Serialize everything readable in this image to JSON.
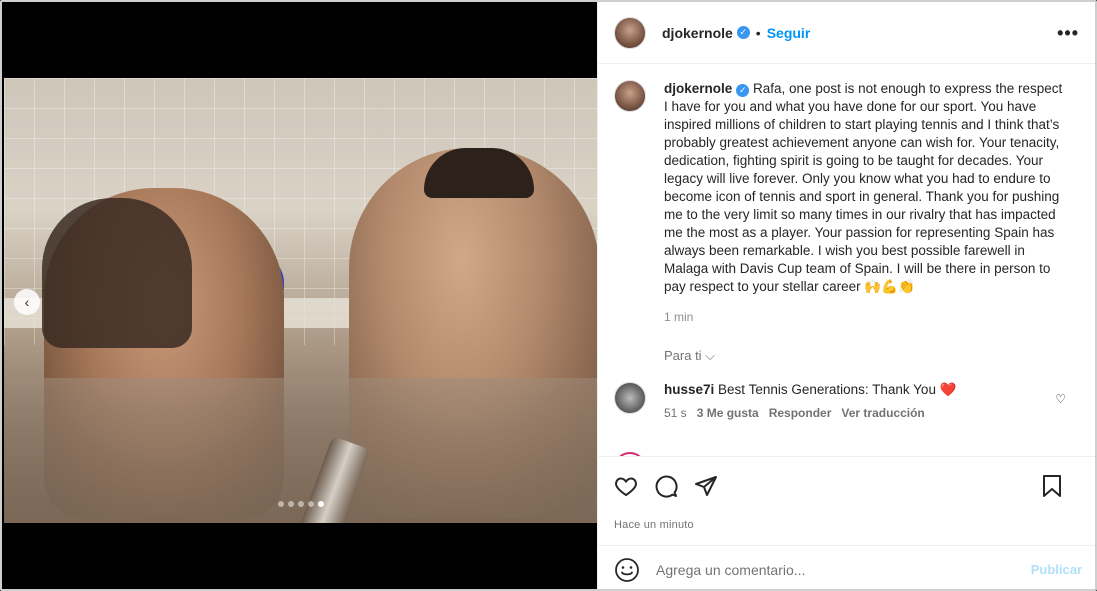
{
  "post": {
    "username": "djokernole",
    "follow_label": "Seguir",
    "more_label": "•••",
    "carousel": {
      "prev_label": "‹",
      "dot_count": 5,
      "active_index": 4
    }
  },
  "caption": {
    "username": "djokernole",
    "text": "Rafa, one post is not enough to express the respect I have for you and what you have done for our sport. You have inspired millions of children to start playing tennis and I think that’s probably greatest achievement anyone can wish for. Your tenacity, dedication, fighting spirit is going to be taught for decades. Your legacy will live forever. Only you know what you had to endure to become icon of tennis and sport in general. Thank you for pushing me to the very limit so many times in our rivalry that has impacted me the most as a player. Your passion for representing Spain has always been remarkable. I wish you best possible farewell in Malaga with Davis Cup team of Spain. I will be there in person to pay respect to your stellar career 🙌💪👏",
    "time": "1 min"
  },
  "para_ti": "Para ti ⌵",
  "comments": [
    {
      "username": "husse7i",
      "text": "Best Tennis Generations: Thank You ❤️",
      "time": "51 s",
      "likes": "3 Me gusta",
      "reply": "Responder",
      "translate": "Ver traducción"
    }
  ],
  "actions": {
    "timestamp": "Hace un minuto"
  },
  "add_comment": {
    "placeholder": "Agrega un comentario...",
    "publish": "Publicar"
  },
  "colors": {
    "accent": "#0095f6",
    "verified": "#3897f0",
    "publish_disabled": "#b2dffc"
  },
  "icons": [
    "chevron-left-icon",
    "verified-badge-icon",
    "more-icon",
    "heart-icon",
    "comment-icon",
    "share-icon",
    "bookmark-icon",
    "emoji-icon"
  ]
}
